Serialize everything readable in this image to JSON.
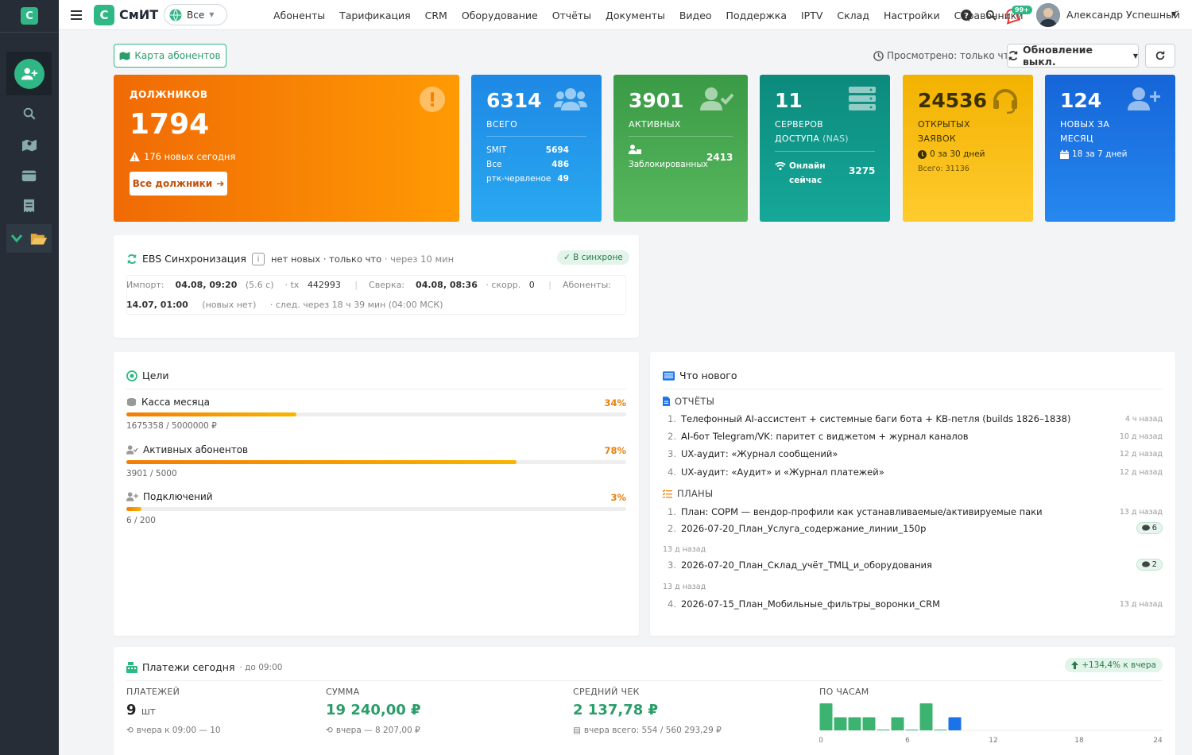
{
  "sidebar": {
    "logo": "C"
  },
  "topbar": {
    "logo": "С",
    "name": "СмИТ",
    "scope": "Все",
    "notif_badge": "99+",
    "user": "Александр Успешный"
  },
  "nav": [
    "Абоненты",
    "Тарификация",
    "CRM",
    "Оборудование",
    "Отчёты",
    "Документы",
    "Видео",
    "Поддержка",
    "IPTV",
    "Склад",
    "Настройки",
    "Справочники"
  ],
  "toolbar": {
    "map_btn": "Карта абонентов",
    "viewed": "Просмотрено: только что",
    "update_btn": "Обновление выкл."
  },
  "cards": {
    "debtors": {
      "label": "ДОЛЖНИКОВ",
      "value": "1794",
      "new_today": "176 новых сегодня",
      "button": "Все должники"
    },
    "total": {
      "value": "6314",
      "label": "ВСЕГО",
      "rows": [
        {
          "k": "SMIT",
          "v": "5694"
        },
        {
          "k": "Все",
          "v": "486"
        },
        {
          "k": "ртк-червленое",
          "v": "49"
        }
      ]
    },
    "active": {
      "value": "3901",
      "label": "АКТИВНЫХ",
      "blocked_label": "Заблокированных",
      "blocked_value": "2413"
    },
    "servers": {
      "value": "11",
      "label1": "СЕРВЕРОВ",
      "label2": "ДОСТУПА",
      "label2b": "(NAS)",
      "online_label": "Онлайн",
      "online_label2": "сейчас",
      "online_value": "3275"
    },
    "tickets": {
      "value": "24536",
      "label1": "ОТКРЫТЫХ",
      "label2": "ЗАЯВОК",
      "sub": "0 за 30 дней",
      "total": "Всего: 31136"
    },
    "newmonth": {
      "value": "124",
      "label1": "НОВЫХ ЗА",
      "label2": "МЕСЯЦ",
      "sub": "18 за 7 дней"
    }
  },
  "ebs": {
    "title": "EBS Синхронизация",
    "info": "нет новых · только что",
    "next": "· через 10 мин",
    "status": "✓ В синхроне",
    "import_l": "Импорт:",
    "import_v": "04.08, 09:20",
    "import_d": "(5.6 с)",
    "tx_l": "· tx",
    "tx_v": "442993",
    "sep": "|",
    "sv_l": "Сверка:",
    "sv_v": "04.08, 08:36",
    "sk_l": "· скорр.",
    "sk_v": "0",
    "ab_l": "Абоненты:",
    "ab_v": "14.07, 01:00",
    "ab_d": "(новых нет)",
    "nextrun": "· след. через 18 ч 39 мин (04:00 МСК)"
  },
  "goals": {
    "title": "Цели",
    "items": [
      {
        "label": "Касса месяца",
        "pct": "34%",
        "value": 0.34,
        "sub": "1675358 / 5000000 ₽"
      },
      {
        "label": "Активных абонентов",
        "pct": "78%",
        "value": 0.78,
        "sub": "3901 / 5000"
      },
      {
        "label": "Подключений",
        "pct": "3%",
        "value": 0.03,
        "sub": "6 / 200"
      }
    ]
  },
  "news": {
    "title": "Что нового",
    "reports_title": "ОТЧЁТЫ",
    "reports": [
      {
        "n": "1.",
        "text": "Телефонный AI-ассистент + системные баги бота + KB-петля (builds 1826–1838)",
        "time": "4 ч назад"
      },
      {
        "n": "2.",
        "text": "AI-бот Telegram/VK: паритет с виджетом + журнал каналов",
        "time": "10 д назад"
      },
      {
        "n": "3.",
        "text": "UX-аудит: «Журнал сообщений»",
        "time": "12 д назад"
      },
      {
        "n": "4.",
        "text": "UX-аудит: «Аудит» и «Журнал платежей»",
        "time": "12 д назад"
      }
    ],
    "plans_title": "ПЛАНЫ",
    "plans": [
      {
        "n": "1.",
        "text": "План: СОРМ — вендор-профили как устанавливаемые/активируемые паки",
        "time": "13 д назад"
      },
      {
        "n": "2.",
        "text": "2026-07-20_План_Услуга_содержание_линии_150р",
        "count": "6",
        "time": "13 д назад"
      },
      {
        "n": "3.",
        "text": "2026-07-20_План_Склад_учёт_ТМЦ_и_оборудования",
        "count": "2",
        "time": "13 д назад"
      },
      {
        "n": "4.",
        "text": "2026-07-15_План_Мобильные_фильтры_воронки_CRM",
        "time": "13 д назад"
      }
    ]
  },
  "payments": {
    "title": "Платежи сегодня",
    "until": "· до 09:00",
    "growth": "+134,4% к вчера",
    "count_l": "ПЛАТЕЖЕЙ",
    "count_v": "9",
    "count_u": "шт",
    "count_s": "вчера к 09:00 — 10",
    "sum_l": "СУММА",
    "sum_v": "19 240,00 ₽",
    "sum_s": "вчера — 8 207,00 ₽",
    "avg_l": "СРЕДНИЙ ЧЕК",
    "avg_v": "2 137,78 ₽",
    "avg_s": "вчера всего: 554 / 560 293,29 ₽",
    "hours_l": "ПО ЧАСАМ",
    "hours_ticks": [
      "0",
      "6",
      "12",
      "18",
      "24"
    ],
    "hours": [
      3.3,
      1.6,
      1.6,
      1.6,
      0.1,
      1.6,
      0.1,
      3.3,
      0.1,
      1.6
    ],
    "current_hour": 9,
    "hours_colors": {
      "past": "#3cb371",
      "current": "#1a73e8"
    }
  },
  "colors": {
    "accent": "#2fb785",
    "orange": "#f47d05",
    "blue": "#1e88e5",
    "green": "#43a047",
    "teal": "#0f9d8f",
    "yellow": "#f6b500"
  }
}
